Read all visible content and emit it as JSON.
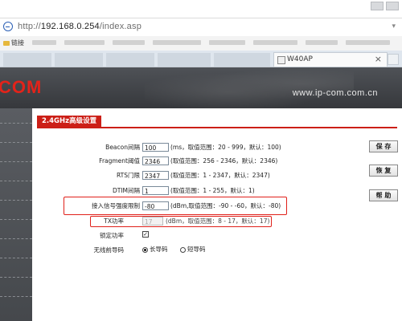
{
  "browser": {
    "url_prefix": "http://",
    "url_host": "192.168.0.254",
    "url_path": "/index.asp",
    "favorites_item": "链接",
    "tab_title": "W40AP"
  },
  "header": {
    "logo_text": "COM",
    "site_url": "www.ip-com.com.cn"
  },
  "section": {
    "title": "2.4GHz高级设置"
  },
  "fields": {
    "beacon": {
      "label": "Beacon间隔",
      "value": "100",
      "hint": "(ms，取值范围：20 - 999，默认：100)"
    },
    "fragment": {
      "label": "Fragment阈值",
      "value": "2346",
      "hint": "(取值范围：256 - 2346，默认：2346)"
    },
    "rts": {
      "label": "RTS门限",
      "value": "2347",
      "hint": "(取值范围：1 - 2347，默认：2347)"
    },
    "dtim": {
      "label": "DTIM间隔",
      "value": "1",
      "hint": "(取值范围：1 - 255，默认：1)"
    },
    "signal_limit": {
      "label": "接入信号强度限制",
      "value": "-80",
      "hint": "(dBm,取值范围：-90 - -60，默认：-80)"
    },
    "tx_power": {
      "label": "TX功率",
      "value": "17",
      "hint": "(dBm，取值范围：8 - 17，默认：17)"
    },
    "lock_power": {
      "label": "锁定功率",
      "checked": true
    },
    "preamble": {
      "label": "无线前导码",
      "options": [
        "长导码",
        "短导码"
      ],
      "selected": "长导码"
    }
  },
  "buttons": {
    "save": "保 存",
    "cancel": "恢 复",
    "help": "帮 助"
  },
  "colors": {
    "brand_red": "#cc1f17",
    "highlight_red": "#e0201a",
    "banner_dark": "#3f4246"
  }
}
